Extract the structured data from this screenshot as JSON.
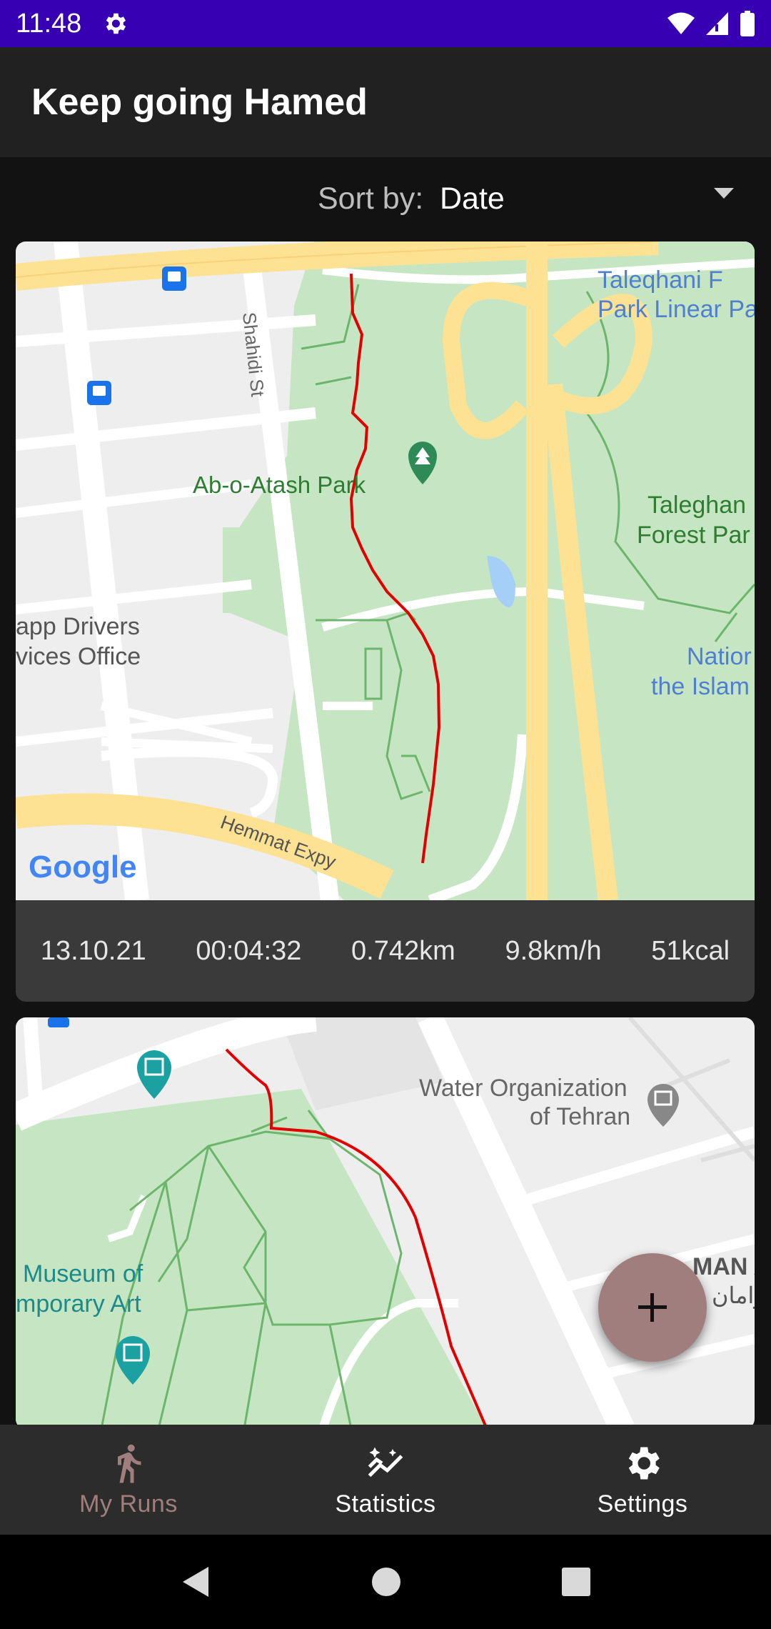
{
  "status_bar": {
    "time": "11:48"
  },
  "app_bar": {
    "title": "Keep going Hamed"
  },
  "sort": {
    "label": "Sort by:",
    "value": "Date"
  },
  "runs": [
    {
      "map_labels": {
        "park1": "Taleqhani F",
        "park2": "Park Linear Pa",
        "street": "Shahidi St",
        "park_main": "Ab-o-Atash Park",
        "forest1": "Taleghan",
        "forest2": "Forest Par",
        "office1": "app Drivers",
        "office2": "vices Office",
        "nation1": "Natior",
        "nation2": "the Islam",
        "expy": "Hemmat Expy",
        "google": "Google"
      },
      "date": "13.10.21",
      "duration": "00:04:32",
      "distance": "0.742km",
      "speed": "9.8km/h",
      "calories": "51kcal"
    },
    {
      "map_labels": {
        "water1": "Water Organization",
        "water2": "of Tehran",
        "museum1": "Museum of",
        "museum2": "mporary Art",
        "man": "MAN A",
        "farsi": "زامان"
      }
    }
  ],
  "fab": {
    "icon": "plus-icon"
  },
  "bottom_nav": [
    {
      "label": "My Runs",
      "icon": "runner-icon"
    },
    {
      "label": "Statistics",
      "icon": "statistics-icon"
    },
    {
      "label": "Settings",
      "icon": "settings-icon"
    }
  ],
  "colors": {
    "status_bar": "#3700B3",
    "accent": "#a07e7e",
    "route": "#e00000"
  }
}
